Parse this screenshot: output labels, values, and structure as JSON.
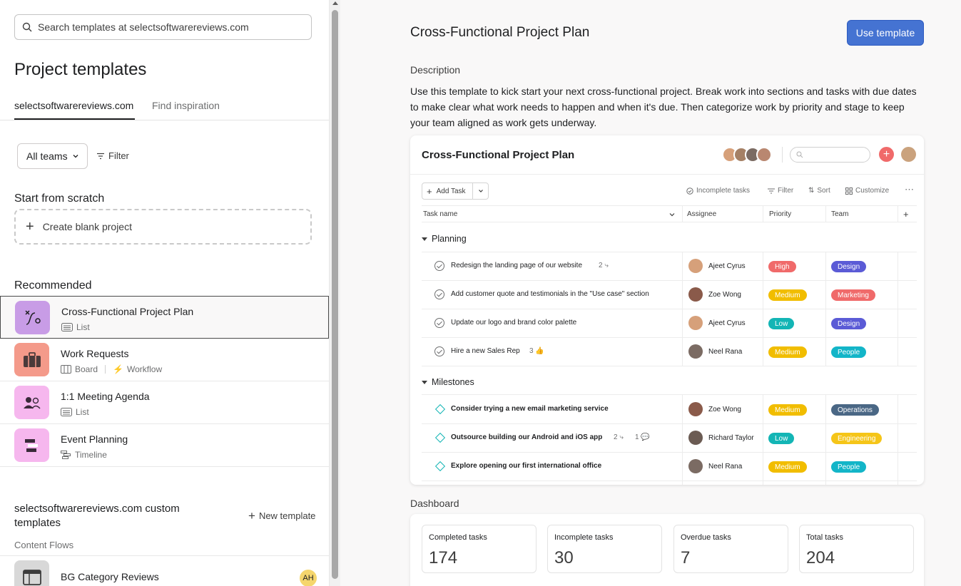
{
  "search": {
    "placeholder": "Search templates at selectsoftwarereviews.com"
  },
  "left": {
    "title": "Project templates",
    "tabs": [
      {
        "label": "selectsoftwarereviews.com"
      },
      {
        "label": "Find inspiration"
      }
    ],
    "teams_label": "All teams",
    "filter_label": "Filter",
    "scratch_title": "Start from scratch",
    "blank_project_label": "Create blank project",
    "recommended_title": "Recommended",
    "templates": [
      {
        "name": "Cross-Functional Project Plan",
        "views": [
          "List"
        ],
        "color": "#c89ce6",
        "icon": "route-icon"
      },
      {
        "name": "Work Requests",
        "views": [
          "Board",
          "Workflow"
        ],
        "color": "#f49a8a",
        "icon": "briefcase-icon"
      },
      {
        "name": "1:1 Meeting Agenda",
        "views": [
          "List"
        ],
        "color": "#f6b7ee",
        "icon": "people-icon"
      },
      {
        "name": "Event Planning",
        "views": [
          "Timeline"
        ],
        "color": "#f6b7ee",
        "icon": "timeline-icon"
      }
    ],
    "custom_title": "selectsoftwarereviews.com custom templates",
    "new_template_label": "New template",
    "content_flows_label": "Content Flows",
    "bg_template": {
      "name": "BG Category Reviews",
      "owner_initials": "AH"
    }
  },
  "right": {
    "title": "Cross-Functional Project Plan",
    "use_template_label": "Use template",
    "description_label": "Description",
    "description": "Use this template to kick start your next cross-functional project. Break work into sections and tasks with due dates to make clear what work needs to happen and when it's due. Then categorize work by priority and stage to keep your team aligned as work gets underway.",
    "preview": {
      "title": "Cross-Functional Project Plan",
      "add_task_label": "Add Task",
      "tools": {
        "incomplete": "Incomplete tasks",
        "filter": "Filter",
        "sort": "Sort",
        "customize": "Customize"
      },
      "columns": {
        "task": "Task name",
        "assignee": "Assignee",
        "priority": "Priority",
        "team": "Team"
      },
      "sections": [
        {
          "name": "Planning",
          "tasks": [
            {
              "name": "Redesign the landing page of our website",
              "sub": "2",
              "assignee": "Ajeet Cyrus",
              "priority": "High",
              "team": "Design"
            },
            {
              "name": "Add customer quote and testimonials in the \"Use case\" section",
              "sub": "",
              "assignee": "Zoe Wong",
              "priority": "Medium",
              "team": "Marketing"
            },
            {
              "name": "Update our logo and brand color palette",
              "sub": "",
              "assignee": "Ajeet Cyrus",
              "priority": "Low",
              "team": "Design"
            },
            {
              "name": "Hire a new Sales Rep",
              "sub": "3",
              "assignee": "Neel Rana",
              "priority": "Medium",
              "team": "People"
            }
          ]
        },
        {
          "name": "Milestones",
          "tasks": [
            {
              "name": "Consider trying a new email marketing service",
              "sub": "",
              "assignee": "Zoe Wong",
              "priority": "Medium",
              "team": "Operations"
            },
            {
              "name": "Outsource building our Android and iOS app",
              "sub": "2",
              "sub2": "1",
              "assignee": "Richard Taylor",
              "priority": "Low",
              "team": "Engineering"
            },
            {
              "name": "Explore opening our first international office",
              "sub": "",
              "assignee": "Neel Rana",
              "priority": "Medium",
              "team": "People"
            }
          ]
        }
      ]
    },
    "dashboard_label": "Dashboard",
    "dashboard": [
      {
        "label": "Completed tasks",
        "value": "174"
      },
      {
        "label": "Incomplete tasks",
        "value": "30"
      },
      {
        "label": "Overdue tasks",
        "value": "7"
      },
      {
        "label": "Total tasks",
        "value": "204"
      }
    ],
    "colors": {
      "accent": "#4573d2",
      "High": "#f06a6a",
      "Medium": "#f1bd00",
      "Low": "#13b5b5",
      "Design": "#5b5bd6",
      "Marketing": "#f06a6a",
      "People": "#13b5c8",
      "Operations": "#4a6785",
      "Engineering": "#f5c518"
    }
  }
}
